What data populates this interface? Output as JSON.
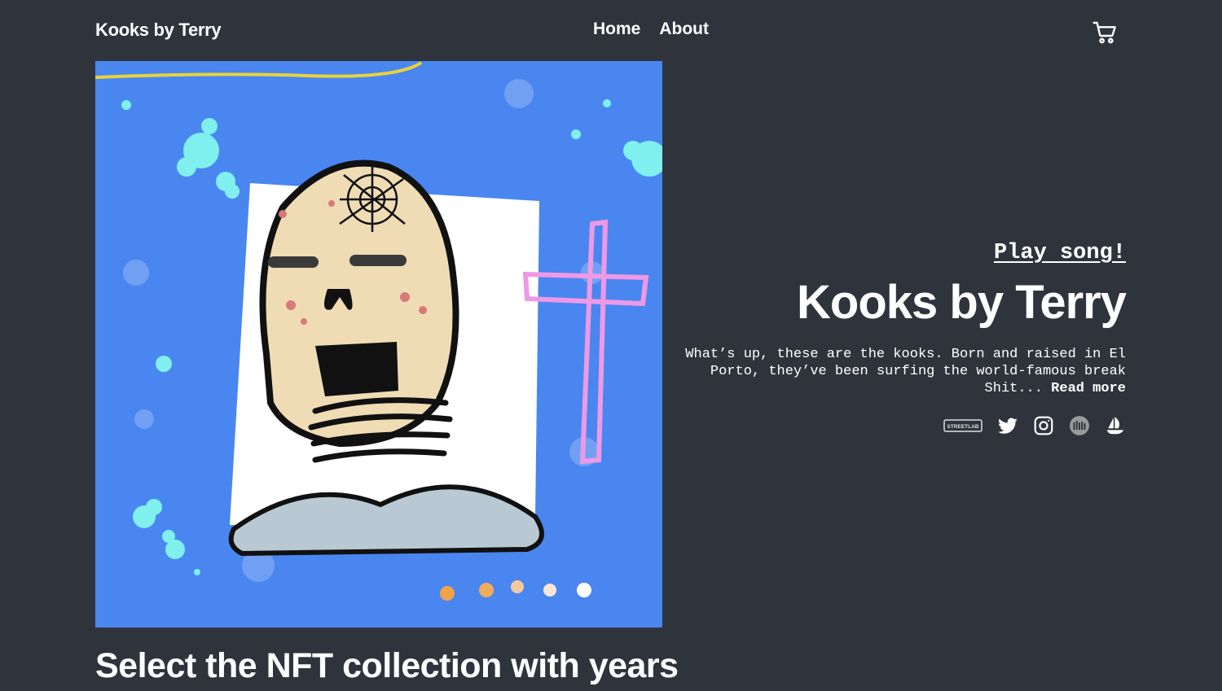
{
  "header": {
    "brand": "Kooks by Terry",
    "nav": [
      {
        "label": "Home"
      },
      {
        "label": "About"
      }
    ],
    "cart_icon": "shopping-cart-icon"
  },
  "hero": {
    "artwork_name": "skull-nft-artwork",
    "play_label": "Play song!",
    "title": "Kooks by Terry",
    "description": "What’s up, these are the kooks. Born and raised in El Porto, they’ve been surfing the world-famous break Shit...",
    "read_more": "Read more",
    "socials": [
      {
        "name": "streetlab-icon",
        "label": "STREETLAB"
      },
      {
        "name": "twitter-icon"
      },
      {
        "name": "instagram-icon"
      },
      {
        "name": "metapond-icon"
      },
      {
        "name": "opensea-icon"
      }
    ]
  },
  "section": {
    "title": "Select the NFT collection with years"
  },
  "colors": {
    "background": "#2f343c",
    "art_bg": "#4a86f0",
    "accent_pink": "#e79be0",
    "text": "#ffffff"
  }
}
